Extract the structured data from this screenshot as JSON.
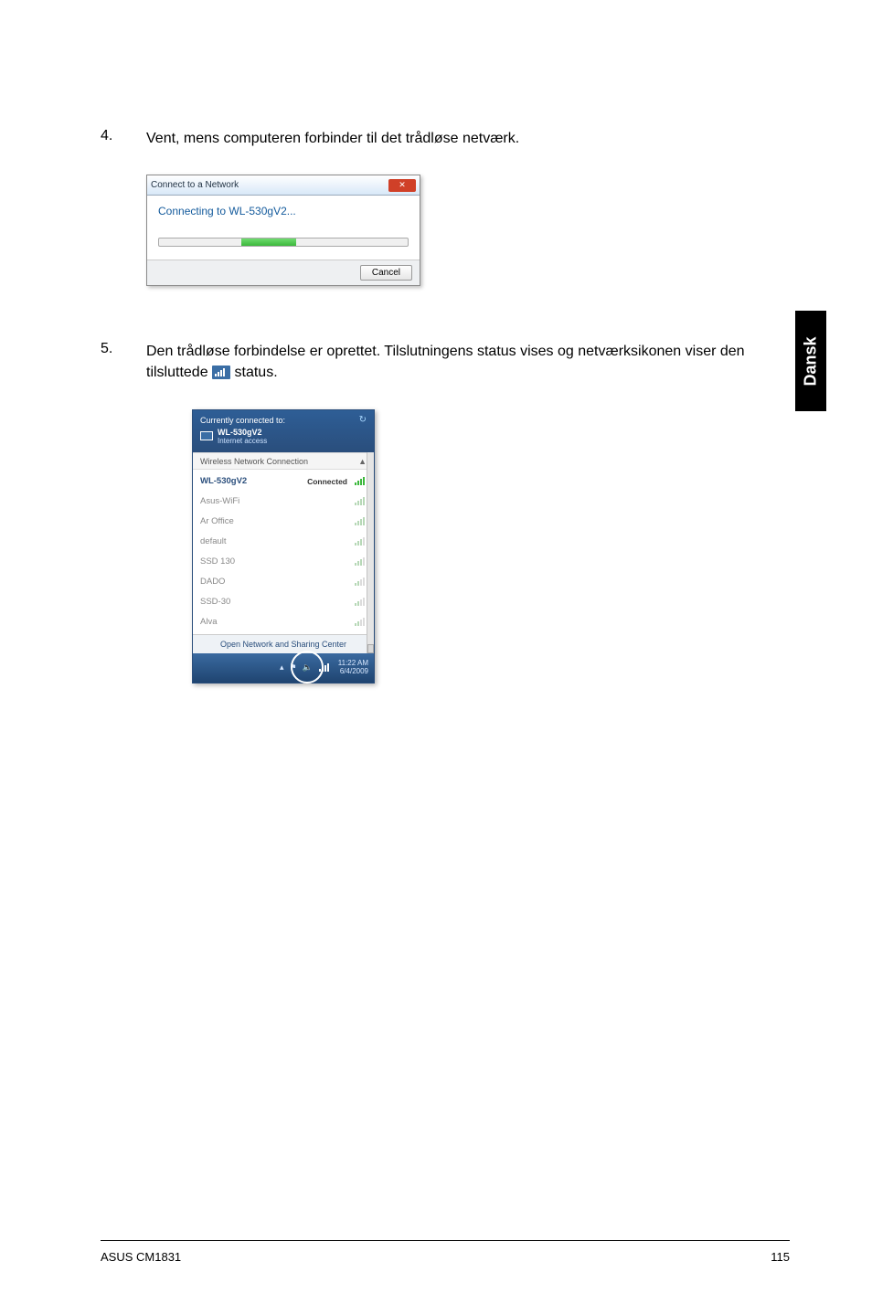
{
  "steps": {
    "s4": {
      "num": "4.",
      "text": "Vent, mens computeren forbinder til det trådløse netværk."
    },
    "s5": {
      "num": "5.",
      "text_a": "Den trådløse forbindelse er oprettet. Tilslutningens status vises og netværksikonen viser den tilsluttede ",
      "text_b": " status."
    }
  },
  "dialog1": {
    "title": "Connect to a Network",
    "connecting": "Connecting to WL-530gV2...",
    "cancel": "Cancel"
  },
  "flyout": {
    "currently": "Currently connected to:",
    "ssid": "WL-530gV2",
    "access": "Internet access",
    "section": "Wireless Network Connection",
    "connected": "Connected",
    "items": [
      {
        "name": "WL-530gV2",
        "status": "Connected",
        "strength": 4,
        "hl": true
      },
      {
        "name": "Asus-WiFi",
        "strength": 4
      },
      {
        "name": "Ar Office",
        "strength": 4
      },
      {
        "name": "default",
        "strength": 3
      },
      {
        "name": "SSD 130",
        "strength": 3
      },
      {
        "name": "DADO",
        "strength": 2
      },
      {
        "name": "SSD-30",
        "strength": 2
      },
      {
        "name": "Alva",
        "strength": 2
      }
    ],
    "link": "Open Network and Sharing Center",
    "time": "11:22 AM",
    "date": "6/4/2009"
  },
  "sideTab": "Dansk",
  "footer": {
    "left": "ASUS CM1831",
    "right": "115"
  }
}
